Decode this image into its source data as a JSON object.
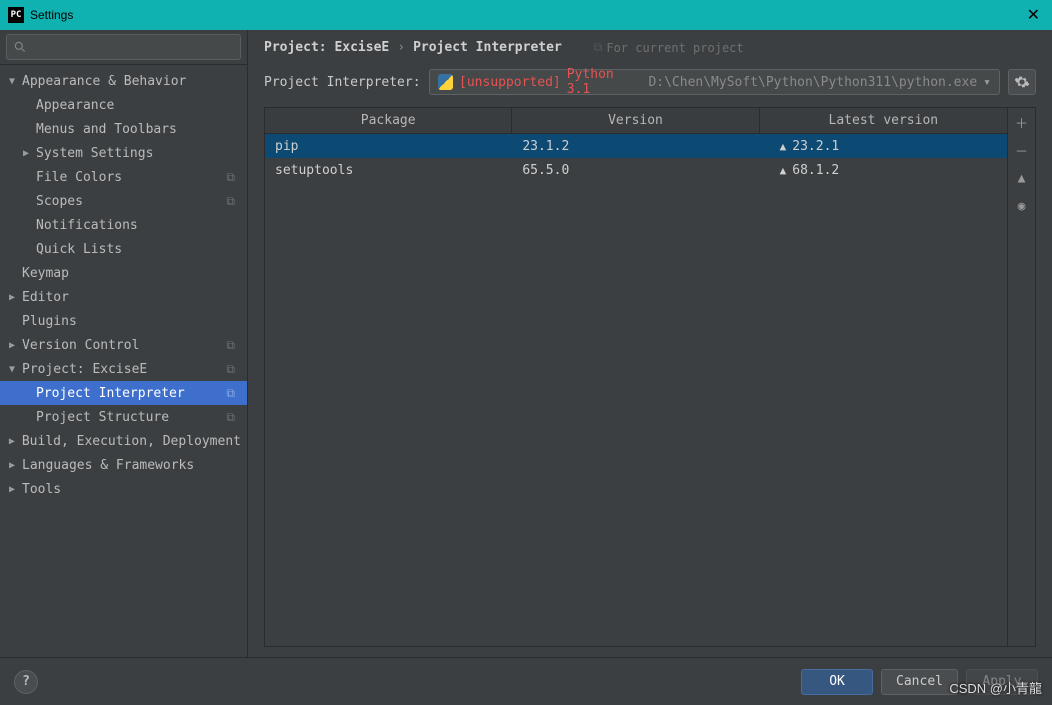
{
  "window": {
    "title": "Settings"
  },
  "search": {
    "placeholder": ""
  },
  "sidebar": {
    "items": [
      {
        "label": "Appearance & Behavior",
        "level": 0,
        "twisty": "▼",
        "copy": false
      },
      {
        "label": "Appearance",
        "level": 1,
        "twisty": "",
        "copy": false
      },
      {
        "label": "Menus and Toolbars",
        "level": 1,
        "twisty": "",
        "copy": false
      },
      {
        "label": "System Settings",
        "level": 1,
        "twisty": "▶",
        "copy": false
      },
      {
        "label": "File Colors",
        "level": 1,
        "twisty": "",
        "copy": true
      },
      {
        "label": "Scopes",
        "level": 1,
        "twisty": "",
        "copy": true
      },
      {
        "label": "Notifications",
        "level": 1,
        "twisty": "",
        "copy": false
      },
      {
        "label": "Quick Lists",
        "level": 1,
        "twisty": "",
        "copy": false
      },
      {
        "label": "Keymap",
        "level": 0,
        "twisty": "",
        "copy": false
      },
      {
        "label": "Editor",
        "level": 0,
        "twisty": "▶",
        "copy": false
      },
      {
        "label": "Plugins",
        "level": 0,
        "twisty": "",
        "copy": false
      },
      {
        "label": "Version Control",
        "level": 0,
        "twisty": "▶",
        "copy": true
      },
      {
        "label": "Project: ExciseE",
        "level": 0,
        "twisty": "▼",
        "copy": true
      },
      {
        "label": "Project Interpreter",
        "level": 1,
        "twisty": "",
        "copy": true,
        "selected": true
      },
      {
        "label": "Project Structure",
        "level": 1,
        "twisty": "",
        "copy": true
      },
      {
        "label": "Build, Execution, Deployment",
        "level": 0,
        "twisty": "▶",
        "copy": false
      },
      {
        "label": "Languages & Frameworks",
        "level": 0,
        "twisty": "▶",
        "copy": false
      },
      {
        "label": "Tools",
        "level": 0,
        "twisty": "▶",
        "copy": false
      }
    ]
  },
  "breadcrumb": {
    "project_label": "Project: ExciseE",
    "page_label": "Project Interpreter",
    "hint": "For current project"
  },
  "interpreter": {
    "label": "Project Interpreter:",
    "unsupported": "[unsupported]",
    "version": "Python 3.1",
    "path": "D:\\Chen\\MySoft\\Python\\Python311\\python.exe"
  },
  "table": {
    "headers": {
      "pkg": "Package",
      "ver": "Version",
      "latest": "Latest version"
    },
    "rows": [
      {
        "pkg": "pip",
        "ver": "23.1.2",
        "latest": "23.2.1",
        "selected": true
      },
      {
        "pkg": "setuptools",
        "ver": "65.5.0",
        "latest": "68.1.2",
        "selected": false
      }
    ]
  },
  "buttons": {
    "ok": "OK",
    "cancel": "Cancel",
    "apply": "Apply"
  },
  "watermark": "CSDN @小青龍"
}
